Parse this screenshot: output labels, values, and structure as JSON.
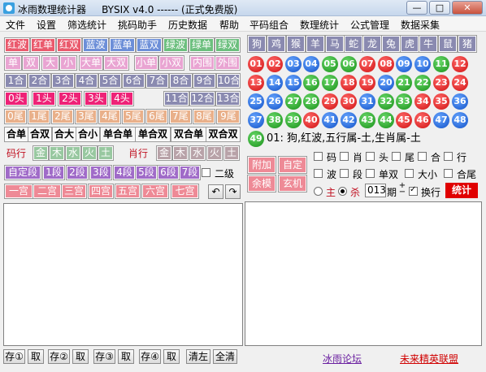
{
  "title": "冰雨数理统计器     BYSIX v4.0 ------ (正式免费版)",
  "window_buttons": {
    "minimize": "—",
    "maximize": "□",
    "close": "✕"
  },
  "menu": [
    "文件",
    "设置",
    "筛选统计",
    "挑码助手",
    "历史数据",
    "帮助",
    "平码组合",
    "数理统计",
    "公式管理",
    "数据采集"
  ],
  "left": {
    "bose": [
      "红波",
      "红单",
      "红双",
      "蓝波",
      "蓝单",
      "蓝双",
      "绿波",
      "绿单",
      "绿双"
    ],
    "danshuang": [
      "单",
      "双",
      "大",
      "小",
      "大单",
      "大双",
      "小单",
      "小双",
      "内围",
      "外围"
    ],
    "he": [
      "1合",
      "2合",
      "3合",
      "4合",
      "5合",
      "6合",
      "7合",
      "8合",
      "9合",
      "10合",
      "11合",
      "12合",
      "13合"
    ],
    "tou": [
      "0头",
      "1头",
      "2头",
      "3头",
      "4头"
    ],
    "wei": [
      "0尾",
      "1尾",
      "2尾",
      "3尾",
      "4尾",
      "5尾",
      "6尾",
      "7尾",
      "8尾",
      "9尾"
    ],
    "hedanshuang": [
      "合单",
      "合双",
      "合大",
      "合小",
      "单合单",
      "单合双",
      "双合单",
      "双合双"
    ],
    "maxing_label": "码行",
    "wuxing": [
      "金",
      "木",
      "水",
      "火",
      "土"
    ],
    "xiaoxing_label": "肖行",
    "duan": [
      "自定段",
      "1段",
      "2段",
      "3段",
      "4段",
      "5段",
      "6段",
      "7段"
    ],
    "erji_label": "二级",
    "gong": [
      "一宫",
      "二宫",
      "三宫",
      "四宫",
      "五宫",
      "六宫",
      "七宫"
    ]
  },
  "zodiac": [
    "狗",
    "鸡",
    "猴",
    "羊",
    "马",
    "蛇",
    "龙",
    "兔",
    "虎",
    "牛",
    "鼠",
    "猪"
  ],
  "balls": [
    {
      "n": "01",
      "c": "red"
    },
    {
      "n": "02",
      "c": "red"
    },
    {
      "n": "03",
      "c": "blue"
    },
    {
      "n": "04",
      "c": "blue"
    },
    {
      "n": "05",
      "c": "green"
    },
    {
      "n": "06",
      "c": "green"
    },
    {
      "n": "07",
      "c": "red"
    },
    {
      "n": "08",
      "c": "red"
    },
    {
      "n": "09",
      "c": "blue"
    },
    {
      "n": "10",
      "c": "blue"
    },
    {
      "n": "11",
      "c": "green"
    },
    {
      "n": "12",
      "c": "red"
    },
    {
      "n": "13",
      "c": "red"
    },
    {
      "n": "14",
      "c": "blue"
    },
    {
      "n": "15",
      "c": "blue"
    },
    {
      "n": "16",
      "c": "green"
    },
    {
      "n": "17",
      "c": "green"
    },
    {
      "n": "18",
      "c": "red"
    },
    {
      "n": "19",
      "c": "red"
    },
    {
      "n": "20",
      "c": "blue"
    },
    {
      "n": "21",
      "c": "green"
    },
    {
      "n": "22",
      "c": "green"
    },
    {
      "n": "23",
      "c": "red"
    },
    {
      "n": "24",
      "c": "red"
    },
    {
      "n": "25",
      "c": "blue"
    },
    {
      "n": "26",
      "c": "blue"
    },
    {
      "n": "27",
      "c": "green"
    },
    {
      "n": "28",
      "c": "green"
    },
    {
      "n": "29",
      "c": "red"
    },
    {
      "n": "30",
      "c": "red"
    },
    {
      "n": "31",
      "c": "blue"
    },
    {
      "n": "32",
      "c": "green"
    },
    {
      "n": "33",
      "c": "green"
    },
    {
      "n": "34",
      "c": "red"
    },
    {
      "n": "35",
      "c": "red"
    },
    {
      "n": "36",
      "c": "blue"
    },
    {
      "n": "37",
      "c": "blue"
    },
    {
      "n": "38",
      "c": "green"
    },
    {
      "n": "39",
      "c": "green"
    },
    {
      "n": "40",
      "c": "red"
    },
    {
      "n": "41",
      "c": "blue"
    },
    {
      "n": "42",
      "c": "blue"
    },
    {
      "n": "43",
      "c": "green"
    },
    {
      "n": "44",
      "c": "green"
    },
    {
      "n": "45",
      "c": "red"
    },
    {
      "n": "46",
      "c": "red"
    },
    {
      "n": "47",
      "c": "blue"
    },
    {
      "n": "48",
      "c": "blue"
    },
    {
      "n": "49",
      "c": "green"
    }
  ],
  "ball_info": "01: 狗,红波,五行属-土,生肖属-土",
  "right_buttons": {
    "fujia": "附加",
    "ziding": "自定",
    "yumo": "余模",
    "xuanji": "玄机"
  },
  "options_row1": [
    "码",
    "肖",
    "头",
    "尾",
    "合",
    "行"
  ],
  "options_row2": [
    "波",
    "段",
    "单双",
    "大小",
    "合尾"
  ],
  "mode": {
    "zhu": "主",
    "sha": "杀",
    "qi_value": "013",
    "qi_label": "期",
    "huanxing": "换行",
    "tongji": "统计"
  },
  "bottom": {
    "slots": [
      {
        "save": "存①",
        "take": "取"
      },
      {
        "save": "存②",
        "take": "取"
      },
      {
        "save": "存③",
        "take": "取"
      },
      {
        "save": "存④",
        "take": "取"
      }
    ],
    "clear_left": "清左",
    "clear_all": "全清",
    "link1": "冰雨论坛",
    "link2": "未来精英联盟"
  },
  "colors": {
    "red": "#ea5a6d",
    "blue": "#6d8fd8",
    "green": "#6cbf7e",
    "tongji": "#e00000",
    "link1": "#6a1fa0",
    "link2": "#d00000"
  }
}
